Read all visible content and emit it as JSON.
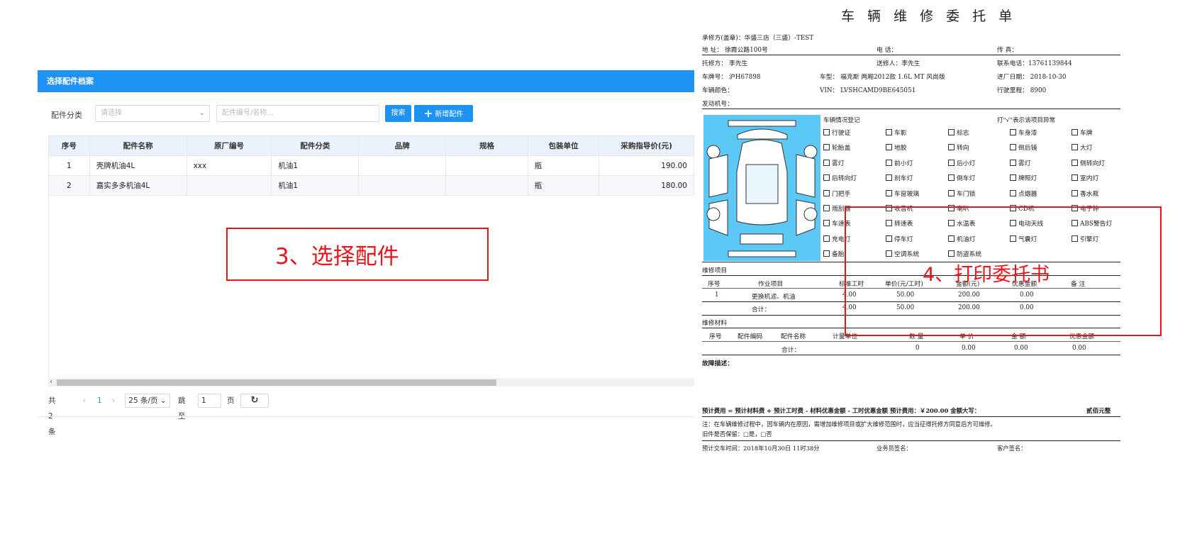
{
  "panel": {
    "title": "选择配件档案",
    "filter_label": "配件分类",
    "select_placeholder": "请选择",
    "search_placeholder": "配件编号/名称...",
    "search_button": "搜索",
    "add_button": "新增配件",
    "columns": [
      "序号",
      "配件名称",
      "原厂编号",
      "配件分类",
      "品牌",
      "规格",
      "包装单位",
      "采购指导价(元)"
    ],
    "rows": [
      {
        "no": "1",
        "name": "壳牌机油4L",
        "oem": "xxx",
        "category": "机油1",
        "brand": "",
        "spec": "",
        "unit": "瓶",
        "price": "190.00"
      },
      {
        "no": "2",
        "name": "嘉实多多机油4L",
        "oem": "",
        "category": "机油1",
        "brand": "",
        "spec": "",
        "unit": "瓶",
        "price": "180.00"
      }
    ],
    "pager": {
      "total": "共 2 条",
      "prev": "‹",
      "page": "1",
      "next": "›",
      "page_size": "25 条/页",
      "goto_label": "跳至",
      "goto_value": "1",
      "page_suffix": "页",
      "refresh_icon": "refresh-icon"
    },
    "callout": "3、选择配件"
  },
  "doc": {
    "title": "车 辆 维 修 委 托 单",
    "header_lines": {
      "repairer": "承修方(盖章)：华盛三店（三盛）-TEST",
      "address": "地 址：    徐霞公路100号",
      "phone": "电 话：",
      "fax": "传 真：",
      "client": "托修方：  李先生",
      "sender": "送修人：李先生",
      "contact": "联系电话：13761139844",
      "plate": "车牌号：  沪H67898",
      "model": "车型：  福克斯 两厢2012款 1.6L MT 风尚版",
      "entry_date": "进厂日期：  2018-10-30",
      "color": "车辆颜色：",
      "vin": "VIN：  LVSHCAMD9BE645051",
      "mileage": "行驶里程：  8900",
      "engine": "发动机号："
    },
    "inspection_title": "车辆情况登记",
    "inspection_note": "打\"√\"表示该项目异常",
    "checklist": [
      [
        "行驶证",
        "车影",
        "标志",
        "车身漆",
        "车牌"
      ],
      [
        "轮胎盖",
        "地胶",
        "转向",
        "倒后镜",
        "大灯"
      ],
      [
        "雾灯",
        "前小灯",
        "后小灯",
        "雾灯",
        "侧转向灯"
      ],
      [
        "后转向灯",
        "刹车灯",
        "倒车灯",
        "牌照灯",
        "室内灯"
      ],
      [
        "门把手",
        "车窗玻璃",
        "车门锁",
        "点烟器",
        "香水瓶"
      ],
      [
        "雨刮器",
        "收音机",
        "喇叭",
        "CD机",
        "电子钟"
      ],
      [
        "车速表",
        "转速表",
        "水温表",
        "电动天线",
        "ABS警告灯"
      ],
      [
        "充电灯",
        "停车灯",
        "机油灯",
        "气囊灯",
        "引擎灯"
      ],
      [
        "备胎",
        "空调系统",
        "防盗系统"
      ]
    ],
    "work_section": "维修项目",
    "work_columns": [
      "序号",
      "作业项目",
      "标准工时",
      "单价(元/工时)",
      "金额(元)",
      "优惠金额",
      "备 注"
    ],
    "work_rows": [
      [
        "1",
        "更换机滤、机油",
        "4.00",
        "50.00",
        "200.00",
        "0.00",
        ""
      ]
    ],
    "work_total": [
      "合计：",
      "4.00",
      "50.00",
      "200.00",
      "0.00"
    ],
    "material_section": "维修材料",
    "material_columns": [
      "序号",
      "配件编码",
      "配件名称",
      "计量单位",
      "数 量",
      "单 价",
      "金 额",
      "优惠金额"
    ],
    "material_total": [
      "合计：",
      "0",
      "0.00",
      "0.00",
      "0.00"
    ],
    "fault_label": "故障描述：",
    "summary": "预计费用 = 预计材料费 + 预计工时费 - 材料优惠金额 - 工时优惠金额      预计费用：￥200.00      金额大写：",
    "summary_amount": "贰佰元整",
    "note": "注：在车辆维修过程中，因车辆内在原因，需增加维修项目或扩大维修范围时，应当征得托修方同意后方可维修。",
    "old_parts": "旧件是否保留：□是，□否",
    "delivery": "预计交车时间：2018年10月30日 11时38分",
    "service_sign": "业务员签名：",
    "customer_sign": "客户签名：",
    "callout": "4、打印委托书"
  },
  "colors": {
    "accent": "#1f93f4",
    "callout": "#e8151a",
    "car_bg": "#5bc8f5"
  }
}
